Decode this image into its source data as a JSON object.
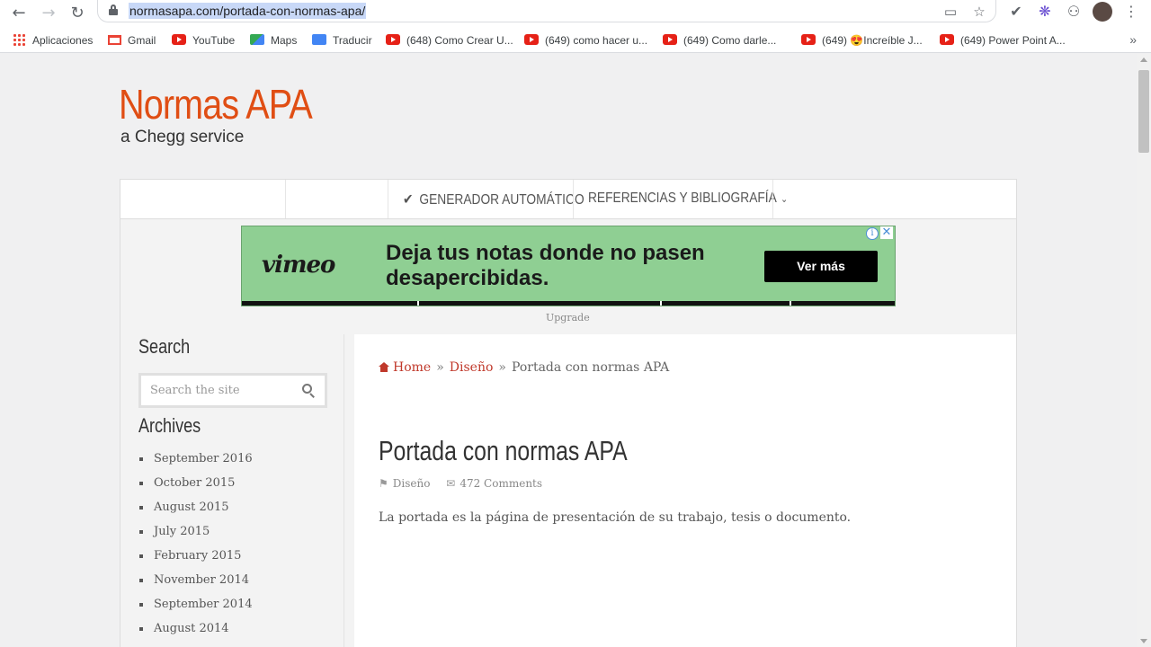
{
  "browser": {
    "url": "normasapa.com/portada-con-normas-apa/",
    "bookmarks": [
      {
        "label": "Aplicaciones",
        "icon": "apps-grid-icon"
      },
      {
        "label": "Gmail",
        "icon": "gmail-icon"
      },
      {
        "label": "YouTube",
        "icon": "youtube-icon"
      },
      {
        "label": "Maps",
        "icon": "maps-icon"
      },
      {
        "label": "Traducir",
        "icon": "translate-icon"
      },
      {
        "label": "(648) Como Crear U...",
        "icon": "youtube-icon"
      },
      {
        "label": "(649) como hacer u...",
        "icon": "youtube-icon"
      },
      {
        "label": "(649) Como darle...",
        "icon": "youtube-icon"
      },
      {
        "label": "(649) 😍Increíble J...",
        "icon": "youtube-icon"
      },
      {
        "label": "(649) Power Point A...",
        "icon": "youtube-icon"
      }
    ],
    "more_bookmarks": "»"
  },
  "site": {
    "title": "Normas APA",
    "subtitle": "a Chegg service",
    "accent": "#e04e14",
    "nav": {
      "generator": "GENERADOR AUTOMÁTICO",
      "references": "REFERENCIAS Y BIBLIOGRAFÍA"
    }
  },
  "ad": {
    "brand": "vimeo",
    "headline": "Deja tus notas donde no pasen desapercibidas.",
    "cta": "Ver más",
    "background": "#8fcf93",
    "info": "i",
    "close": "✕",
    "upgrade": "Upgrade"
  },
  "sidebar": {
    "search_title": "Search",
    "search_placeholder": "Search the site",
    "archives_title": "Archives",
    "archives": [
      "September 2016",
      "October 2015",
      "August 2015",
      "July 2015",
      "February 2015",
      "November 2014",
      "September 2014",
      "August 2014"
    ]
  },
  "main": {
    "breadcrumb": {
      "home": "Home",
      "category": "Diseño",
      "current": "Portada con normas APA",
      "separator": "»"
    },
    "title": "Portada con normas APA",
    "meta": {
      "category": "Diseño",
      "comments": "472 Comments"
    },
    "body": "La portada es la página de presentación de su trabajo, tesis o documento."
  }
}
